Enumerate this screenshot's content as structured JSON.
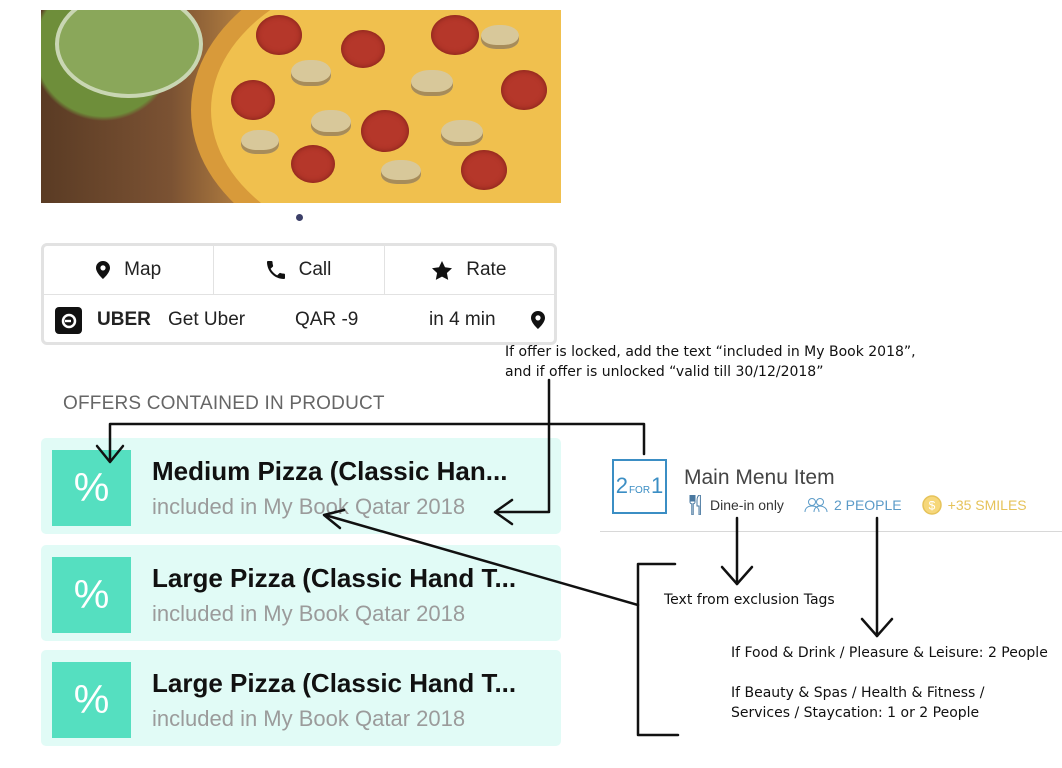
{
  "actions": {
    "map_label": "Map",
    "call_label": "Call",
    "rate_label": "Rate",
    "uber_brand": "UBER",
    "uber_action": "Get Uber",
    "uber_price": "QAR -9",
    "uber_eta": "in 4 min"
  },
  "offers_heading": "OFFERS CONTAINED IN PRODUCT",
  "offers": [
    {
      "title": "Medium Pizza (Classic Han...",
      "subtitle": "included in My Book Qatar 2018",
      "icon": "%"
    },
    {
      "title": "Large Pizza (Classic Hand T...",
      "subtitle": "included in My Book Qatar 2018",
      "icon": "%"
    },
    {
      "title": "Large Pizza (Classic Hand T...",
      "subtitle": "included in My Book Qatar 2018",
      "icon": "%"
    }
  ],
  "menu_item": {
    "badge_left": "2",
    "badge_mid": "FOR",
    "badge_right": "1",
    "title": "Main Menu Item",
    "exclusion_tag": "Dine-in only",
    "people": "2 PEOPLE",
    "smiles": "+35 SMILES"
  },
  "annotations": {
    "locked_note_line1": "If offer is locked, add the text “included in My Book 2018”,",
    "locked_note_line2": "and if offer is unlocked “valid till 30/12/2018”",
    "exclusion_note": "Text from exclusion Tags",
    "people_note_1": "If Food & Drink / Pleasure & Leisure: 2 People",
    "people_note_2a": "If Beauty & Spas / Health & Fitness /",
    "people_note_2b": "Services / Staycation: 1 or 2 People"
  },
  "colors": {
    "accent_teal": "#55dfc0",
    "offer_bg": "#e1fbf6",
    "badge_blue": "#3b8ec4",
    "smiles_gold": "#e6c35a"
  }
}
